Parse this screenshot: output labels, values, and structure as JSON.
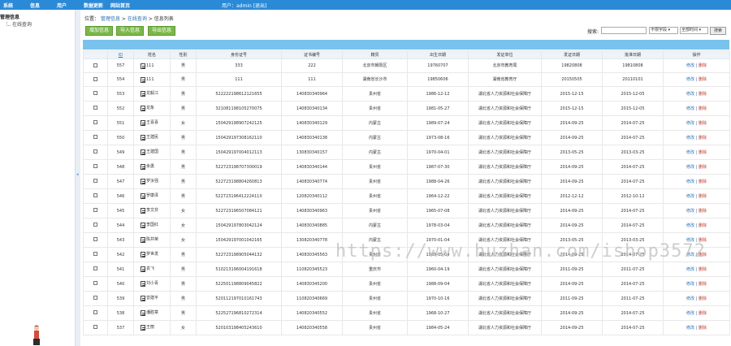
{
  "topbar": {
    "nav": [
      "系统",
      "信息",
      "用户",
      "数据更新",
      "网站首页"
    ],
    "user": "用户：admin   [退出]"
  },
  "sidebar": {
    "title": "管理信息",
    "item": "在线查询"
  },
  "breadcrumb": {
    "prefix": "位置：",
    "item1": "管理信息",
    "item2": "在线查询",
    "item3": "信息列表"
  },
  "toolbar": {
    "add": "增加信息",
    "import": "导入信息",
    "export": "导出信息",
    "search_label": "搜索:",
    "search_value": "",
    "field_select": "不限字段",
    "time_select": "全部时间",
    "search_button": "搜索"
  },
  "table": {
    "headers": [
      "ID",
      "姓名",
      "性别",
      "身份证号",
      "证书编号",
      "籍贯",
      "出生日期",
      "发证单位",
      "发证日期",
      "批准日期",
      "操作"
    ],
    "edit_label": "修改",
    "sep": "|",
    "delete_label": "删除",
    "rows": [
      {
        "id": "557",
        "name": "111",
        "gender": "男",
        "idno": "333",
        "cert": "222",
        "origin": "北京市朝阳区",
        "birth": "19760707",
        "issuer": "北京市教育局",
        "issue": "19820808",
        "approve": "19810808"
      },
      {
        "id": "554",
        "name": "111",
        "gender": "男",
        "idno": "111",
        "cert": "111",
        "origin": "湖南省长沙市",
        "birth": "19850606",
        "issuer": "湖南省教育厅",
        "issue": "20150505",
        "approve": "20110101"
      },
      {
        "id": "553",
        "name": "龙毅江",
        "gender": "男",
        "idno": "522222198612121655",
        "cert": "140830340964",
        "origin": "贵州省",
        "birth": "1986-12-12",
        "issuer": "湖北省人力资源和社会保障厅",
        "issue": "2015-12-15",
        "approve": "2015-12-05"
      },
      {
        "id": "552",
        "name": "龙象",
        "gender": "男",
        "idno": "321081198105270075",
        "cert": "140830340134",
        "origin": "贵州省",
        "birth": "1981-05-27",
        "issuer": "湖北省人力资源和社会保障厅",
        "issue": "2015-12-15",
        "approve": "2015-12-05"
      },
      {
        "id": "551",
        "name": "王喜喜",
        "gender": "女",
        "idno": "150429198907242125",
        "cert": "140830340129",
        "origin": "内蒙古",
        "birth": "1989-07-24",
        "issuer": "湖北省人力资源和社会保障厅",
        "issue": "2014-09-25",
        "approve": "2014-07-25"
      },
      {
        "id": "550",
        "name": "王建民",
        "gender": "男",
        "idno": "150429197308162110",
        "cert": "140830340138",
        "origin": "内蒙古",
        "birth": "1973-08-16",
        "issuer": "湖北省人力资源和社会保障厅",
        "issue": "2014-09-25",
        "approve": "2014-07-25"
      },
      {
        "id": "549",
        "name": "王建国",
        "gender": "男",
        "idno": "150429197004012113",
        "cert": "130830340157",
        "origin": "内蒙古",
        "birth": "1970-04-01",
        "issuer": "湖北省人力资源和社会保障厅",
        "issue": "2013-05-25",
        "approve": "2013-03-25"
      },
      {
        "id": "548",
        "name": "余勇",
        "gender": "男",
        "idno": "522723198707300019",
        "cert": "140830340144",
        "origin": "贵州省",
        "birth": "1987-07-30",
        "issuer": "湖北省人力资源和社会保障厅",
        "issue": "2014-09-25",
        "approve": "2014-07-25"
      },
      {
        "id": "547",
        "name": "罗汝强",
        "gender": "男",
        "idno": "522723198804260813",
        "cert": "140830340774",
        "origin": "贵州省",
        "birth": "1988-04-26",
        "issuer": "湖北省人力资源和社会保障厅",
        "issue": "2014-09-25",
        "approve": "2014-07-25"
      },
      {
        "id": "546",
        "name": "罗康泽",
        "gender": "男",
        "idno": "52272319641222411X",
        "cert": "120820340112",
        "origin": "贵州省",
        "birth": "1964-12-22",
        "issuer": "湖北省人力资源和社会保障厅",
        "issue": "2012-12-12",
        "approve": "2012-10-12"
      },
      {
        "id": "545",
        "name": "李文芬",
        "gender": "女",
        "idno": "522723196507084121",
        "cert": "140830340963",
        "origin": "贵州省",
        "birth": "1965-07-08",
        "issuer": "湖北省人力资源和社会保障厅",
        "issue": "2014-09-25",
        "approve": "2014-07-25"
      },
      {
        "id": "544",
        "name": "李国红",
        "gender": "女",
        "idno": "150429197803042124",
        "cert": "140830340885",
        "origin": "内蒙古",
        "birth": "1978-03-04",
        "issuer": "湖北省人力资源和社会保障厅",
        "issue": "2014-09-25",
        "approve": "2014-07-25"
      },
      {
        "id": "543",
        "name": "陈井荣",
        "gender": "女",
        "idno": "150429197001042165",
        "cert": "130820340778",
        "origin": "内蒙古",
        "birth": "1970-01-04",
        "issuer": "湖北省人力资源和社会保障厅",
        "issue": "2013-05-25",
        "approve": "2013-03-25"
      },
      {
        "id": "542",
        "name": "罗世发",
        "gender": "男",
        "idno": "522723198905044132",
        "cert": "140830345563",
        "origin": "贵州省",
        "birth": "1989-05-04",
        "issuer": "湖北省人力资源和社会保障厅",
        "issue": "2014-09-25",
        "approve": "2014-07-25"
      },
      {
        "id": "541",
        "name": "袁飞",
        "gender": "男",
        "idno": "510213196004191618",
        "cert": "110820345523",
        "origin": "重庆市",
        "birth": "1960-04-19",
        "issuer": "湖北省人力资源和社会保障厅",
        "issue": "2011-09-25",
        "approve": "2011-07-25"
      },
      {
        "id": "540",
        "name": "刘小青",
        "gender": "男",
        "idno": "522501198809045822",
        "cert": "140830345200",
        "origin": "贵州省",
        "birth": "1988-09-04",
        "issuer": "湖北省人力资源和社会保障厅",
        "issue": "2014-09-25",
        "approve": "2014-07-25"
      },
      {
        "id": "539",
        "name": "曾建平",
        "gender": "男",
        "idno": "520112197010161743",
        "cert": "110820340669",
        "origin": "贵州省",
        "birth": "1970-10-16",
        "issuer": "湖北省人力资源和社会保障厅",
        "issue": "2011-09-25",
        "approve": "2011-07-25"
      },
      {
        "id": "538",
        "name": "潘胜章",
        "gender": "男",
        "idno": "522527196810272314",
        "cert": "140820340552",
        "origin": "贵州省",
        "birth": "1968-10-27",
        "issuer": "湖北省人力资源和社会保障厅",
        "issue": "2014-09-25",
        "approve": "2014-07-25"
      },
      {
        "id": "537",
        "name": "王丽",
        "gender": "女",
        "idno": "520103198405243610",
        "cert": "140820340558",
        "origin": "贵州省",
        "birth": "1984-05-24",
        "issuer": "湖北省人力资源和社会保障厅",
        "issue": "2014-09-25",
        "approve": "2014-07-25"
      }
    ]
  },
  "watermark": "https://www.huzhan.com/ishop3572",
  "colors": {
    "topbar": "#2b8ad8",
    "table_header_bar": "#79c2ee",
    "button_green": "#7bb84a",
    "link": "#2a6fb5"
  }
}
